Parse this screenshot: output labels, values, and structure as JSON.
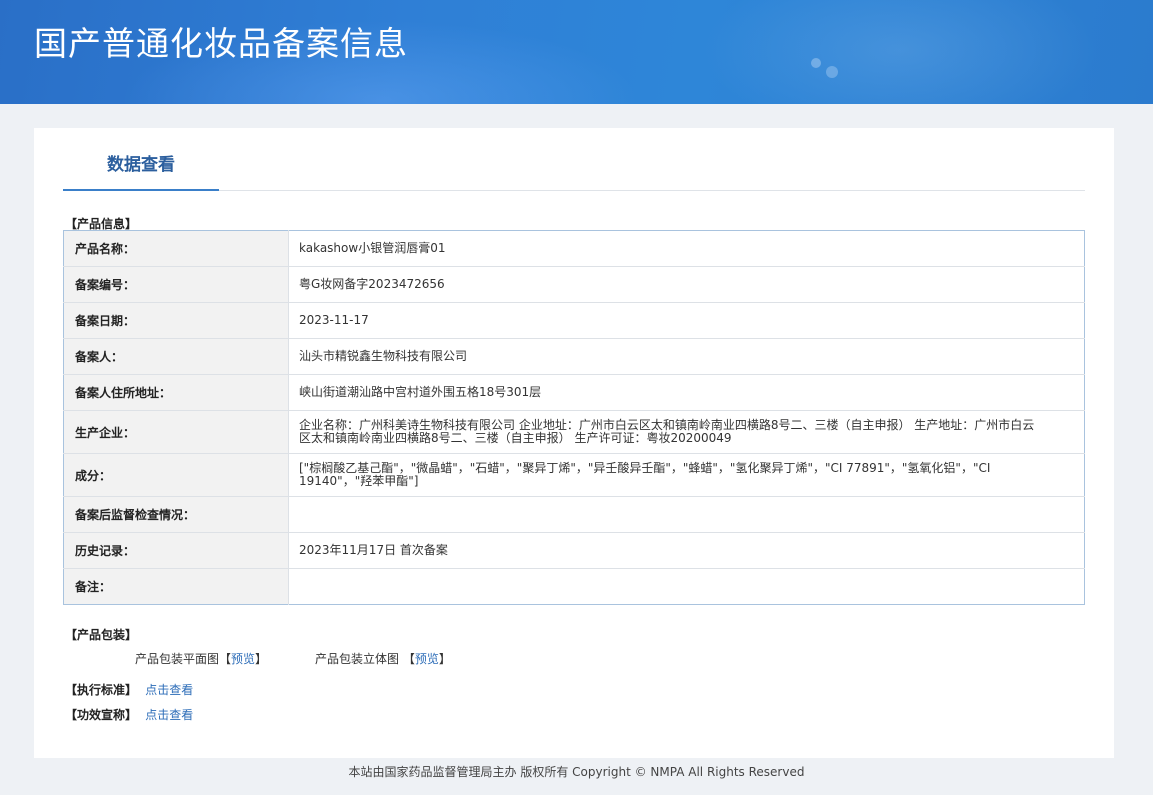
{
  "banner": {
    "title": "国产普通化妆品备案信息"
  },
  "tabs": [
    {
      "label": "数据查看"
    }
  ],
  "product_info": {
    "section_label": "【产品信息】",
    "rows": [
      {
        "key": "产品名称：",
        "value": "kakashow小银管润唇膏01"
      },
      {
        "key": "备案编号：",
        "value": "粤G妆网备字2023472656"
      },
      {
        "key": "备案日期：",
        "value": "2023-11-17"
      },
      {
        "key": "备案人：",
        "value": "汕头市精锐鑫生物科技有限公司"
      },
      {
        "key": "备案人住所地址：",
        "value": "峡山街道潮汕路中宫村道外围五格18号301层"
      },
      {
        "key": "生产企业：",
        "value": "企业名称：广州科美诗生物科技有限公司 企业地址：广州市白云区太和镇南岭南业四横路8号二、三楼（自主申报） 生产地址：广州市白云区太和镇南岭南业四横路8号二、三楼（自主申报） 生产许可证：粤妆20200049"
      },
      {
        "key": "成分：",
        "value": "[\"棕榈酸乙基己酯\"，\"微晶蜡\"，\"石蜡\"，\"聚异丁烯\"，\"异壬酸异壬酯\"，\"蜂蜡\"，\"氢化聚异丁烯\"，\"CI 77891\"，\"氢氧化铝\"，\"CI 19140\"，\"羟苯甲酯\"]"
      },
      {
        "key": "备案后监督检查情况：",
        "value": ""
      },
      {
        "key": "历史记录：",
        "value": "2023年11月17日 首次备案"
      },
      {
        "key": "备注：",
        "value": ""
      }
    ]
  },
  "packaging": {
    "section_label": "【产品包装】",
    "flat_label": "产品包装平面图",
    "flat_link": "预览",
    "solid_label": "产品包装立体图",
    "solid_link": "预览",
    "bracket_open": "【",
    "bracket_close": "】"
  },
  "standard": {
    "section_label": "【执行标准】",
    "link": "点击查看"
  },
  "efficacy": {
    "section_label": "【功效宣称】",
    "link": "点击查看"
  },
  "footer": {
    "text": "本站由国家药品监督管理局主办 版权所有 Copyright © NMPA All Rights Reserved"
  }
}
